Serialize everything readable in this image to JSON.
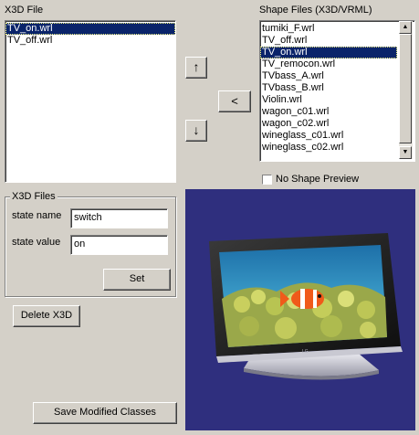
{
  "x3d_panel": {
    "title": "X3D File",
    "files": [
      {
        "name": "TV_on.wrl",
        "selected": true
      },
      {
        "name": "TV_off.wrl",
        "selected": false
      }
    ]
  },
  "shape_panel": {
    "title": "Shape Files (X3D/VRML)",
    "files": [
      {
        "name": "tumiki_F.wrl",
        "selected": false
      },
      {
        "name": "TV_off.wrl",
        "selected": false
      },
      {
        "name": "TV_on.wrl",
        "selected": true
      },
      {
        "name": "TV_remocon.wrl",
        "selected": false
      },
      {
        "name": "TVbass_A.wrl",
        "selected": false
      },
      {
        "name": "TVbass_B.wrl",
        "selected": false
      },
      {
        "name": "Violin.wrl",
        "selected": false
      },
      {
        "name": "wagon_c01.wrl",
        "selected": false
      },
      {
        "name": "wagon_c02.wrl",
        "selected": false
      },
      {
        "name": "wineglass_c01.wrl",
        "selected": false
      },
      {
        "name": "wineglass_c02.wrl",
        "selected": false
      }
    ],
    "no_preview_label": "No Shape Preview",
    "no_preview_checked": false
  },
  "buttons": {
    "move_up": "↑",
    "move_down": "↓",
    "add": "<",
    "set": "Set",
    "delete_x3d": "Delete X3D",
    "save_modified": "Save Modified Classes"
  },
  "x3d_files_group": {
    "title": "X3D Files",
    "state_name_label": "state name",
    "state_name_value": "switch",
    "state_value_label": "state value",
    "state_value_value": "on"
  },
  "preview": {
    "background_color": "#2f2f7e",
    "screen_brand": "LG"
  }
}
